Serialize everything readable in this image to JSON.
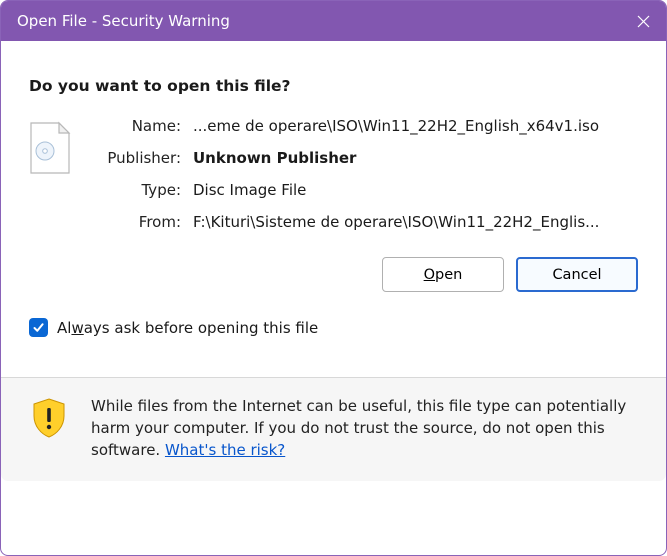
{
  "titlebar": {
    "title": "Open File - Security Warning"
  },
  "heading": "Do you want to open this file?",
  "fields": {
    "name_label": "Name:",
    "name_value": "...eme de operare\\ISO\\Win11_22H2_English_x64v1.iso",
    "publisher_label": "Publisher:",
    "publisher_value": "Unknown Publisher",
    "type_label": "Type:",
    "type_value": "Disc Image File",
    "from_label": "From:",
    "from_value": "F:\\Kituri\\Sisteme de operare\\ISO\\Win11_22H2_Englis..."
  },
  "buttons": {
    "open_prefix": "O",
    "open_rest": "pen",
    "cancel": "Cancel"
  },
  "checkbox": {
    "prefix": "Al",
    "underline": "w",
    "rest": "ays ask before opening this file",
    "checked": true
  },
  "warning": {
    "body": "While files from the Internet can be useful, this file type can potentially harm your computer. If you do not trust the source, do not open this software. ",
    "link": "What's the risk?"
  }
}
